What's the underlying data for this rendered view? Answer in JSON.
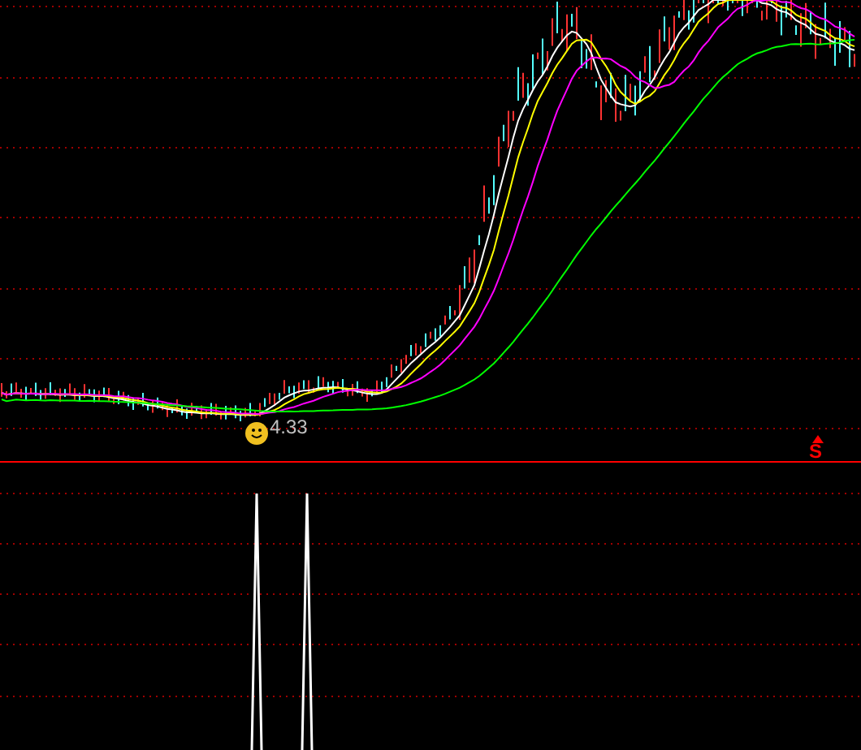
{
  "price_panel": {
    "low_label": "4.33",
    "signal_label": "S"
  }
}
